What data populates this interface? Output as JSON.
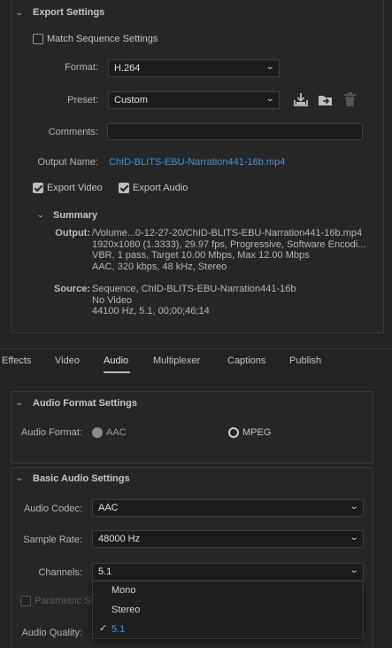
{
  "export_settings": {
    "title": "Export Settings",
    "match_sequence_label": "Match Sequence Settings",
    "format_label": "Format:",
    "format_value": "H.264",
    "preset_label": "Preset:",
    "preset_value": "Custom",
    "comments_label": "Comments:",
    "comments_value": "",
    "output_name_label": "Output Name:",
    "output_name_value": "ChID-BLITS-EBU-Narration441-16b.mp4",
    "export_video_label": "Export Video",
    "export_audio_label": "Export Audio",
    "export_video_checked": true,
    "export_audio_checked": true,
    "match_sequence_checked": false
  },
  "summary": {
    "title": "Summary",
    "output_label": "Output:",
    "output_lines": [
      "/Volume...0-12-27-20/ChID-BLITS-EBU-Narration441-16b.mp4",
      "1920x1080 (1.3333), 29.97 fps, Progressive, Software Encodi...",
      "VBR, 1 pass, Target 10.00 Mbps, Max 12.00 Mbps",
      "AAC, 320 kbps, 48 kHz, Stereo"
    ],
    "source_label": "Source:",
    "source_lines": [
      "Sequence, ChID-BLITS-EBU-Narration441-16b",
      "No Video",
      "44100 Hz, 5.1, 00;00;46;14"
    ]
  },
  "tabs": [
    "Effects",
    "Video",
    "Audio",
    "Multiplexer",
    "Captions",
    "Publish"
  ],
  "active_tab": "Audio",
  "audio_format": {
    "title": "Audio Format Settings",
    "label": "Audio Format:",
    "option_aac": "AAC",
    "option_mpeg": "MPEG",
    "selected": "AAC"
  },
  "basic_audio": {
    "title": "Basic Audio Settings",
    "codec_label": "Audio Codec:",
    "codec_value": "AAC",
    "sample_rate_label": "Sample Rate:",
    "sample_rate_value": "48000 Hz",
    "channels_label": "Channels:",
    "channels_value": "5.1",
    "parametric_label": "Parametric St",
    "quality_label": "Audio Quality:"
  },
  "channels_menu": {
    "items": [
      "Mono",
      "Stereo",
      "5.1"
    ],
    "selected": "5.1"
  },
  "colors": {
    "accent": "#3b97e3",
    "background": "#232323",
    "panel": "#262626"
  },
  "icons": [
    "chevron-down-icon",
    "save-preset-icon",
    "import-preset-icon",
    "trash-icon",
    "checkmark-icon"
  ]
}
